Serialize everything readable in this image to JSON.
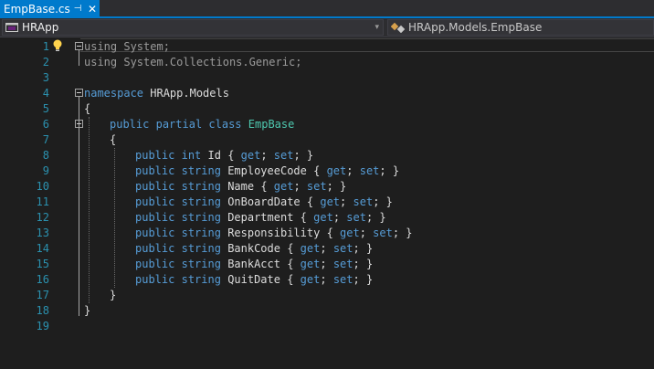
{
  "tab": {
    "title": "EmpBase.cs",
    "pin_glyph": "⊣",
    "close_glyph": "✕"
  },
  "nav": {
    "project": "HRApp",
    "member": "HRApp.Models.EmpBase",
    "dropdown_glyph": "▾"
  },
  "colors": {
    "accent": "#007acc",
    "keyword": "#569cd6",
    "type": "#4ec9b0",
    "line_number": "#2b91af",
    "text": "#dcdcdc",
    "background": "#1e1e1e"
  },
  "code": {
    "line_numbers": [
      "1",
      "2",
      "3",
      "4",
      "5",
      "6",
      "7",
      "8",
      "9",
      "10",
      "11",
      "12",
      "13",
      "14",
      "15",
      "16",
      "17",
      "18",
      "19"
    ],
    "line1": {
      "kw": "using",
      "rest": " System;"
    },
    "line2": {
      "kw": "using",
      "rest": " System.Collections.Generic;"
    },
    "line4": {
      "kw": "namespace",
      "rest": " HRApp.Models"
    },
    "line5": {
      "text": "{"
    },
    "line6": {
      "kw1": "public",
      "kw2": "partial",
      "kw3": "class",
      "cls": "EmpBase"
    },
    "line7": {
      "text": "{"
    },
    "properties": [
      {
        "kw": "public",
        "type": "int",
        "name": "Id"
      },
      {
        "kw": "public",
        "type": "string",
        "name": "EmployeeCode"
      },
      {
        "kw": "public",
        "type": "string",
        "name": "Name"
      },
      {
        "kw": "public",
        "type": "string",
        "name": "OnBoardDate"
      },
      {
        "kw": "public",
        "type": "string",
        "name": "Department"
      },
      {
        "kw": "public",
        "type": "string",
        "name": "Responsibility"
      },
      {
        "kw": "public",
        "type": "string",
        "name": "BankCode"
      },
      {
        "kw": "public",
        "type": "string",
        "name": "BankAcct"
      },
      {
        "kw": "public",
        "type": "string",
        "name": "QuitDate"
      }
    ],
    "accessor": {
      "open": " { ",
      "get": "get",
      "sep": "; ",
      "set": "set",
      "close": "; }"
    },
    "line17": {
      "text": "}"
    },
    "line18": {
      "text": "}"
    }
  }
}
